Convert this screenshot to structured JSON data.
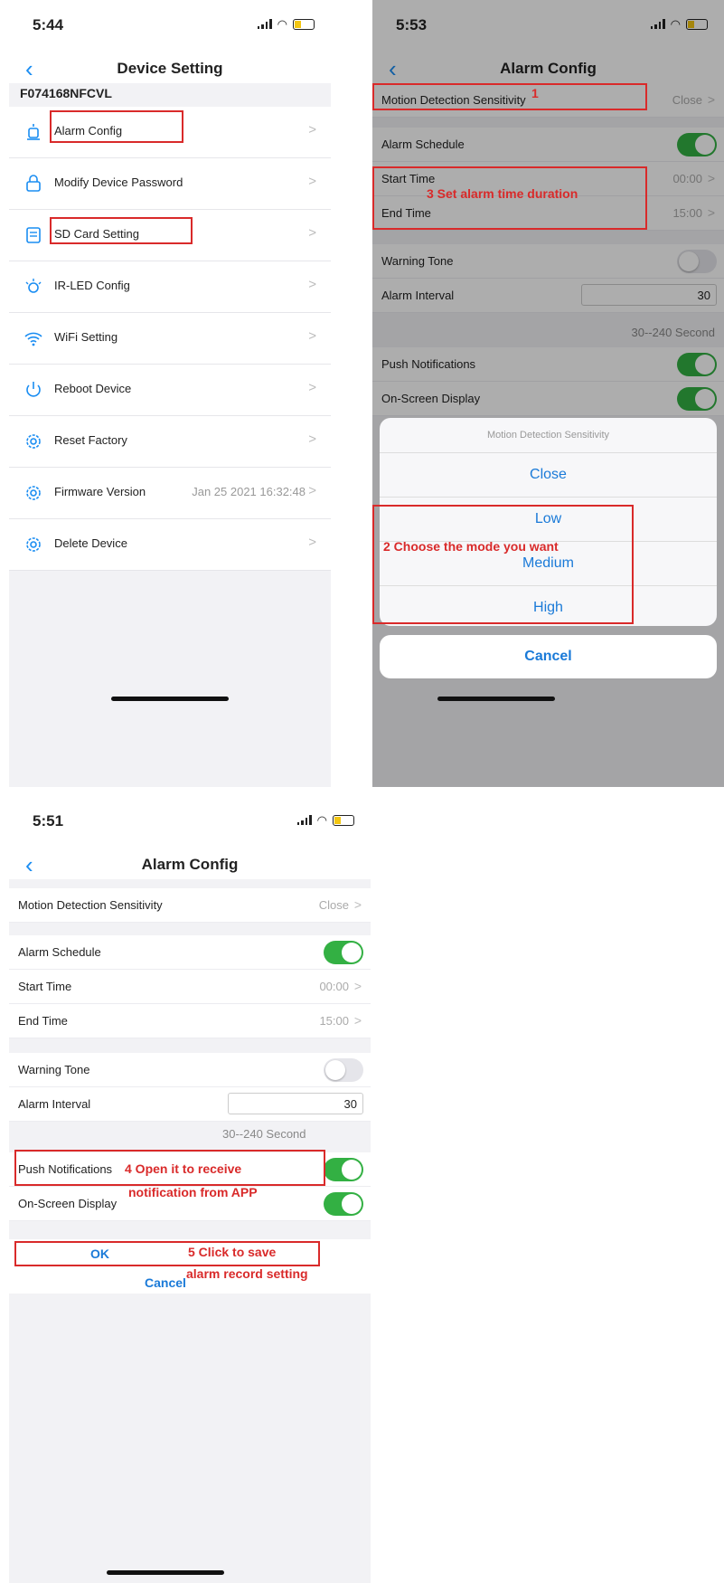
{
  "panel1": {
    "time": "5:44",
    "title": "Device Setting",
    "device_id": "F074168NFCVL",
    "items": [
      {
        "label": "Alarm Config",
        "value": ""
      },
      {
        "label": "Modify Device Password",
        "value": ""
      },
      {
        "label": "SD Card Setting",
        "value": ""
      },
      {
        "label": "IR-LED Config",
        "value": ""
      },
      {
        "label": "WiFi Setting",
        "value": ""
      },
      {
        "label": "Reboot Device",
        "value": ""
      },
      {
        "label": "Reset Factory",
        "value": ""
      },
      {
        "label": "Firmware Version",
        "value": "Jan 25 2021 16:32:48"
      },
      {
        "label": "Delete Device",
        "value": ""
      }
    ],
    "chevron": ">"
  },
  "panel2": {
    "time": "5:53",
    "title": "Alarm Config",
    "motion_label": "Motion Detection Sensitivity",
    "motion_value": "Close",
    "annot1": "1",
    "alarm_schedule": "Alarm Schedule",
    "start_time_label": "Start Time",
    "start_time_value": "00:00",
    "end_time_label": "End Time",
    "end_time_value": "15:00",
    "annot3": "3 Set alarm time duration",
    "warning_tone": "Warning Tone",
    "alarm_interval": "Alarm Interval",
    "alarm_interval_value": "30",
    "interval_hint": "30--240 Second",
    "push": "Push Notifications",
    "osd": "On-Screen Display",
    "sheet_title": "Motion Detection Sensitivity",
    "options": [
      "Close",
      "Low",
      "Medium",
      "High"
    ],
    "annot2": "2  Choose the mode you want",
    "cancel": "Cancel"
  },
  "panel3": {
    "time": "5:51",
    "title": "Alarm Config",
    "motion_label": "Motion Detection Sensitivity",
    "motion_value": "Close",
    "alarm_schedule": "Alarm Schedule",
    "start_time_label": "Start Time",
    "start_time_value": "00:00",
    "end_time_label": "End Time",
    "end_time_value": "15:00",
    "warning_tone": "Warning Tone",
    "alarm_interval": "Alarm Interval",
    "alarm_interval_value": "30",
    "interval_hint": "30--240 Second",
    "push": "Push Notifications",
    "osd": "On-Screen Display",
    "annot4a": "4 Open it to receive",
    "annot4b": "notification from APP",
    "ok": "OK",
    "annot5a": "5 Click to save",
    "annot5b": "alarm record setting",
    "cancel": "Cancel"
  },
  "colors": {
    "accent": "#1a7ad8",
    "toggle_on": "#33b043",
    "annotation": "#d92a2a"
  }
}
